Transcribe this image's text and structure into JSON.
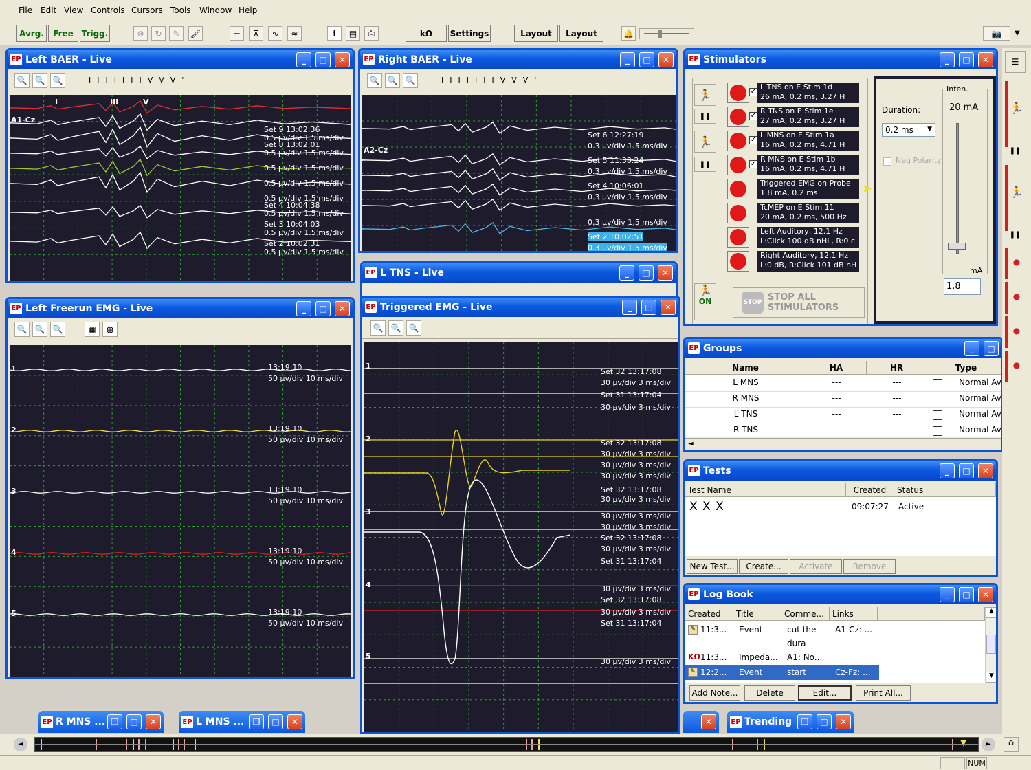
{
  "menu": [
    "File",
    "Edit",
    "View",
    "Controls",
    "Cursors",
    "Tools",
    "Window",
    "Help"
  ],
  "toolbar": {
    "avrg": "Avrg.",
    "free": "Free",
    "trigg": "Trigg.",
    "kohm": "kΩ",
    "settings": "Settings",
    "layout1": "Layout",
    "layout2": "Layout"
  },
  "left_baer": {
    "title": "Left BAER - Live",
    "channel": "A1-Cz",
    "peak_marks": [
      "I",
      "II",
      "III",
      "IV",
      "V",
      "V'"
    ],
    "peaks": [
      "I",
      "III",
      "V"
    ],
    "sets": [
      {
        "label": "Set 9 13:02:36",
        "scale": "0.5 µv/div 1.5 ms/div"
      },
      {
        "label": "Set 8 13:02:01",
        "scale": "0.5 µv/div 1.5 ms/div"
      },
      {
        "label": "",
        "scale": "0.5 µv/div 1.5 ms/div"
      },
      {
        "label": "",
        "scale": "0.5 µv/div 1.5 ms/div"
      },
      {
        "label": "",
        "scale": "0.5 µv/div 1.5 ms/div"
      },
      {
        "label": "Set 4 10:04:38",
        "scale": "0.5 µv/div 1.5 ms/div"
      },
      {
        "label": "Set 3 10:04:03",
        "scale": "0.5 µv/div 1.5 ms/div"
      },
      {
        "label": "Set 2 10:02:31",
        "scale": "0.5 µv/div 1.5 ms/div"
      }
    ]
  },
  "right_baer": {
    "title": "Right BAER - Live",
    "channel": "A2-Cz",
    "sets": [
      {
        "label": "Set 6 12:27:19",
        "scale": "0.3 µv/div 1.5 ms/div"
      },
      {
        "label": "Set 5 11:38:24",
        "scale": "0.3 µv/div 1.5 ms/div"
      },
      {
        "label": "Set 4 10:06:01",
        "scale": "0.3 µv/div 1.5 ms/div"
      },
      {
        "label": "",
        "scale": "0.3 µv/div 1.5 ms/div"
      },
      {
        "label": "Set 2 10:02:51",
        "scale": "0.3 µv/div 1.5 ms/div"
      }
    ]
  },
  "l_tns": {
    "title": "L TNS - Live"
  },
  "left_freerun": {
    "title": "Left Freerun EMG - Live",
    "channels": [
      {
        "num": "1",
        "time": "13:19:10",
        "scale": "50 µv/div 10 ms/div"
      },
      {
        "num": "2",
        "time": "13:19:10",
        "scale": "50 µv/div 10 ms/div"
      },
      {
        "num": "3",
        "time": "13:19:10",
        "scale": "50 µv/div 10 ms/div"
      },
      {
        "num": "4",
        "time": "13:19:10",
        "scale": "50 µv/div 10 ms/div"
      },
      {
        "num": "5",
        "time": "13:19:10",
        "scale": "50 µv/div 10 ms/div"
      }
    ]
  },
  "triggered_emg": {
    "title": "Triggered EMG - Live",
    "labels": [
      {
        "text": "Set 32 13:17:08"
      },
      {
        "text": "30 µv/div 3 ms/div"
      },
      {
        "text": "Set 31 13:17:04"
      },
      {
        "text": "30 µv/div 3 ms/div"
      },
      {
        "text": "Set 32 13:17:08"
      },
      {
        "text": "30 µv/div 3 ms/div"
      },
      {
        "text": "30 µv/div 3 ms/div"
      },
      {
        "text": "30 µv/div 3 ms/div"
      },
      {
        "text": "Set 32 13:17:08"
      },
      {
        "text": "30 µv/div 3 ms/div"
      },
      {
        "text": "30 µv/div 3 ms/div"
      },
      {
        "text": "30 µv/div 3 ms/div"
      },
      {
        "text": "Set 32 13:17:08"
      },
      {
        "text": "30 µv/div 3 ms/div"
      },
      {
        "text": "Set 31 13:17:04"
      },
      {
        "text": "30 µv/div 3 ms/div"
      },
      {
        "text": "Set 32 13:17:08"
      },
      {
        "text": "30 µv/div 3 ms/div"
      },
      {
        "text": "Set 31 13:17:04"
      },
      {
        "text": "30 µv/div 3 ms/div"
      }
    ],
    "channels": [
      "1",
      "2",
      "3",
      "4",
      "5"
    ]
  },
  "stimulators": {
    "title": "Stimulators",
    "rows": [
      {
        "l1": "L TNS on E Stim 1d",
        "l2": "26 mA, 0.2 ms, 3.27 H",
        "checked": true
      },
      {
        "l1": "R TNS on E Stim 1e",
        "l2": "27 mA, 0.2 ms, 3.27 H",
        "checked": true
      },
      {
        "l1": "L MNS on E Stim 1a",
        "l2": "16 mA, 0.2 ms, 4.71 H",
        "checked": true
      },
      {
        "l1": "R MNS on E Stim 1b",
        "l2": "16 mA, 0.2 ms, 4.71 H",
        "checked": true
      },
      {
        "l1": "Triggered EMG on Probe",
        "l2": "1.8 mA, 0.2 ms",
        "checked": false
      },
      {
        "l1": "TcMEP on E Stim 11",
        "l2": "20 mA, 0.2 ms, 500 Hz",
        "checked": false
      },
      {
        "l1": "Left Auditory, 12.1 Hz",
        "l2": "L:Click 100 dB nHL, R:0 c",
        "checked": false
      },
      {
        "l1": "Right Auditory, 12.1 Hz",
        "l2": "L:0 dB, R:Click 101 dB nH",
        "checked": false
      }
    ],
    "stop_all": "STOP ALL STIMULATORS",
    "stop_sign": "STOP",
    "on_label": "ON",
    "duration_label": "Duration:",
    "duration_value": "0.2 ms",
    "neg_polarity": "Neg Polarity",
    "inten_label": "Inten.",
    "inten_value": "20 mA",
    "unit": "mA",
    "inten_input": "1.8"
  },
  "groups": {
    "title": "Groups",
    "columns": [
      "Name",
      "HA",
      "HR",
      "Type"
    ],
    "rows": [
      {
        "name": "L MNS",
        "ha": "---",
        "hr": "---",
        "type": "Normal Avg"
      },
      {
        "name": "R MNS",
        "ha": "---",
        "hr": "---",
        "type": "Normal Avg"
      },
      {
        "name": "L TNS",
        "ha": "---",
        "hr": "---",
        "type": "Normal Avg"
      },
      {
        "name": "R TNS",
        "ha": "---",
        "hr": "---",
        "type": "Normal Avg"
      }
    ]
  },
  "tests": {
    "title": "Tests",
    "columns": [
      "Test Name",
      "Created",
      "Status"
    ],
    "rows": [
      {
        "name": "X X X",
        "created": "09:07:27",
        "status": "Active"
      }
    ],
    "buttons": [
      "New Test...",
      "Create...",
      "Activate",
      "Remove"
    ]
  },
  "logbook": {
    "title": "Log Book",
    "columns": [
      "Created",
      "Title",
      "Comme...",
      "Links"
    ],
    "rows": [
      {
        "created": "11:3...",
        "title": "Event",
        "comment": "cut the",
        "links": "A1-Cz: ...",
        "comment2": "dura"
      },
      {
        "created": "11:3...",
        "title": "Impeda...",
        "comment": "A1: No...",
        "links": ""
      },
      {
        "created": "12:2...",
        "title": "Event",
        "comment": "start",
        "links": "Cz-Fz: ..."
      }
    ],
    "buttons": [
      "Add Note...",
      "Delete",
      "Edit...",
      "Print All..."
    ]
  },
  "minimized": [
    {
      "title": "R MNS ..."
    },
    {
      "title": "L MNS ..."
    },
    {
      "title": "Trending"
    }
  ],
  "status": {
    "num": "NUM"
  }
}
